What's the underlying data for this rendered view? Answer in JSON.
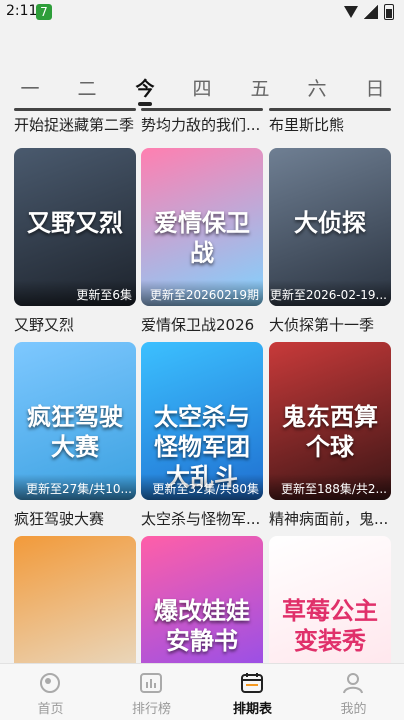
{
  "status": {
    "time": "2:11",
    "badge": "7"
  },
  "week": {
    "days": [
      "一",
      "二",
      "今",
      "四",
      "五",
      "六",
      "日"
    ],
    "active_index": 2
  },
  "top_row": [
    "开始捉迷藏第二季",
    "势均力敌的我们...",
    "布里斯比熊"
  ],
  "cards": [
    {
      "title": "又野又烈",
      "episode": "更新至6集",
      "poster_text": "又野又烈",
      "colors": [
        "#4a5a6e",
        "#1d232c"
      ]
    },
    {
      "title": "爱情保卫战2026",
      "episode": "更新至20260219期",
      "poster_text": "爱情保卫战",
      "colors": [
        "#ff7fb0",
        "#7fd3ff"
      ]
    },
    {
      "title": "大侦探第十一季",
      "episode": "更新至2026-02-19...",
      "poster_text": "大侦探",
      "colors": [
        "#6f7f93",
        "#2a3340"
      ]
    },
    {
      "title": "疯狂驾驶大赛",
      "episode": "更新至27集/共10...",
      "poster_text": "疯狂驾驶大赛",
      "colors": [
        "#7ec8ff",
        "#3aa0e0"
      ]
    },
    {
      "title": "太空杀与怪物军...",
      "episode": "更新至32集/共80集",
      "poster_text": "太空杀与怪物军团大乱斗",
      "colors": [
        "#3cc0ff",
        "#1f6fd0"
      ]
    },
    {
      "title": "精神病面前，鬼...",
      "episode": "更新至188集/共2...",
      "poster_text": "鬼东西算个球",
      "colors": [
        "#c83a3a",
        "#3a1515"
      ]
    },
    {
      "title": "",
      "episode": "",
      "poster_text": "",
      "colors": [
        "#f29a3a",
        "#e8e0d0"
      ]
    },
    {
      "title": "",
      "episode": "",
      "poster_text": "爆改娃娃安静书",
      "colors": [
        "#ff5fa8",
        "#8a4df0"
      ]
    },
    {
      "title": "",
      "episode": "",
      "poster_text": "草莓公主变装秀",
      "colors": [
        "#ffffff",
        "#ffe3ea"
      ]
    }
  ],
  "nav": {
    "items": [
      {
        "label": "首页",
        "icon": "home-icon"
      },
      {
        "label": "排行榜",
        "icon": "ranking-icon"
      },
      {
        "label": "排期表",
        "icon": "calendar-icon"
      },
      {
        "label": "我的",
        "icon": "profile-icon"
      }
    ],
    "active_index": 2
  }
}
